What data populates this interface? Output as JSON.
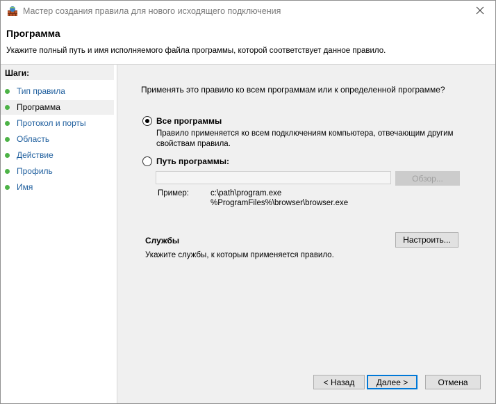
{
  "window": {
    "title": "Мастер создания правила для нового исходящего подключения",
    "close_icon": "close-icon",
    "app_icon": "firewall-icon"
  },
  "header": {
    "title": "Программа",
    "description": "Укажите полный путь и имя исполняемого файла программы, которой соответствует данное правило."
  },
  "steps": {
    "title": "Шаги:",
    "items": [
      {
        "label": "Тип правила",
        "status_color": "#4db347"
      },
      {
        "label": "Программа",
        "status_color": "#4db347",
        "current": true
      },
      {
        "label": "Протокол и порты",
        "status_color": "#4db347"
      },
      {
        "label": "Область",
        "status_color": "#4db347"
      },
      {
        "label": "Действие",
        "status_color": "#4db347"
      },
      {
        "label": "Профиль",
        "status_color": "#4db347"
      },
      {
        "label": "Имя",
        "status_color": "#4db347"
      }
    ]
  },
  "main": {
    "question": "Применять это правило ко всем программам или к определенной программе?",
    "all_programs": {
      "label": "Все программы",
      "description": "Правило применяется ко всем подключениям компьютера, отвечающим другим свойствам правила.",
      "checked": true
    },
    "program_path": {
      "label": "Путь программы:",
      "value": "",
      "checked": false
    },
    "browse_label": "Обзор...",
    "example_label": "Пример:",
    "example_line1": "c:\\path\\program.exe",
    "example_line2": "%ProgramFiles%\\browser\\browser.exe",
    "services_title": "Службы",
    "services_description": "Укажите службы, к которым применяется правило.",
    "configure_label": "Настроить..."
  },
  "footer": {
    "back_label": "< Назад",
    "next_label": "Далее >",
    "cancel_label": "Отмена"
  },
  "colors": {
    "accent": "#0078d7",
    "step_link": "#1f5f9e",
    "step_dot": "#4db347",
    "content_bg": "#f0f0f0"
  }
}
